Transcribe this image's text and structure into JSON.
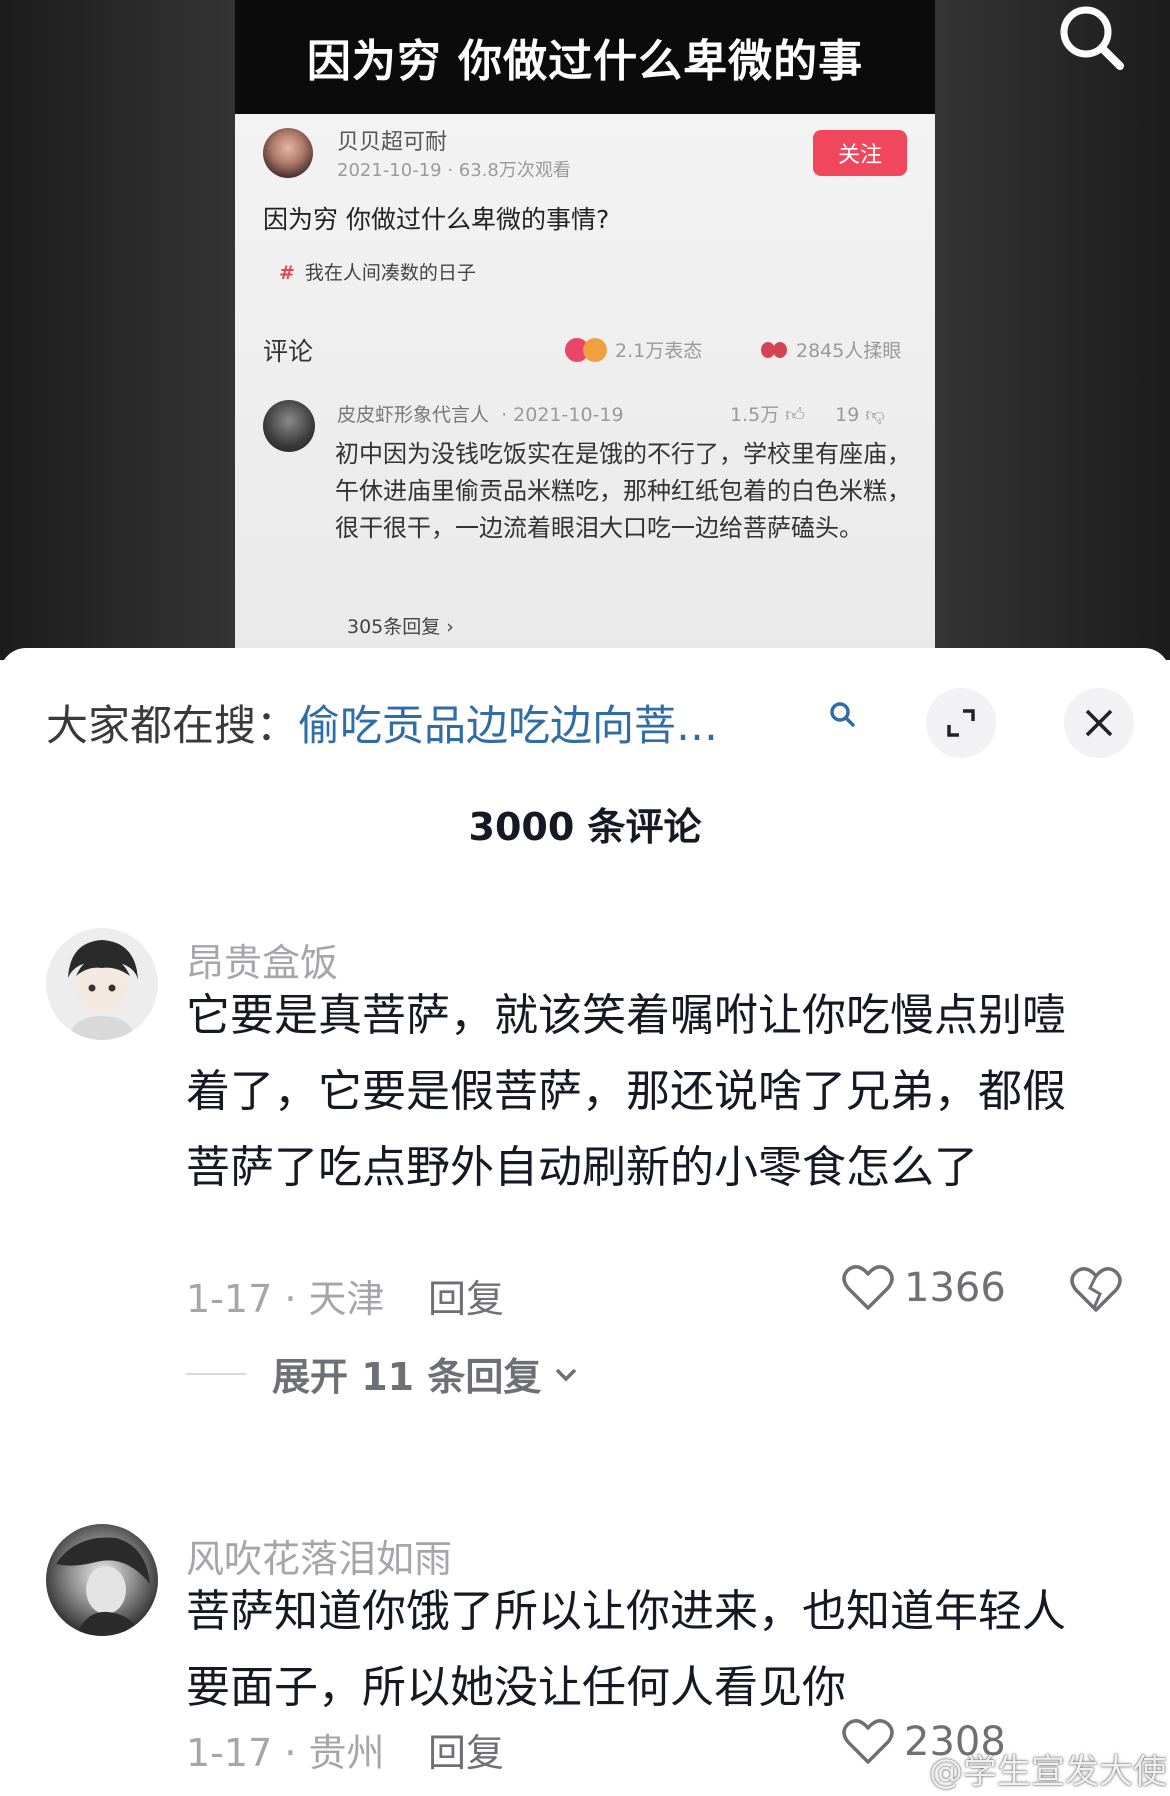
{
  "video": {
    "title": "因为穷 你做过什么卑微的事",
    "search_icon": "search-icon",
    "screenshot": {
      "author": "贝贝超可耐",
      "meta": "2021-10-19 · 63.8万次观看",
      "follow_label": "关注",
      "question": "因为穷 你做过什么卑微的事情?",
      "topic_hash": "#",
      "topic": "我在人间凑数的日子",
      "comments_heading": "评论",
      "reactions": "2.1万表态",
      "rubbed_eyes": "2845人揉眼",
      "comment": {
        "name": "皮皮虾形象代言人",
        "date": "· 2021-10-19",
        "likes": "1.5万",
        "dislikes": "19",
        "text": "初中因为没钱吃饭实在是饿的不行了，学校里有座庙，午休进庙里偷贡品米糕吃，那种红纸包着的白色米糕，很干很干，一边流着眼泪大口吃一边给菩萨磕头。",
        "replies": "305条回复 ›"
      }
    }
  },
  "sheet": {
    "search_prefix": "大家都在搜：",
    "search_term": "偷吃贡品边吃边向菩…",
    "comment_count": "3000 条评论",
    "comments": [
      {
        "author": "昂贵盒饭",
        "text": "它要是真菩萨，就该笑着嘱咐让你吃慢点别噎着了，它要是假菩萨，那还说啥了兄弟，都假菩萨了吃点野外自动刷新的小零食怎么了",
        "meta": "1-17 · 天津",
        "reply_label": "回复",
        "likes": "1366",
        "expand_label": "展开 11 条回复"
      },
      {
        "author": "风吹花落泪如雨",
        "text": "菩萨知道你饿了所以让你进来，也知道年轻人要面子，所以她没让任何人看见你",
        "meta": "1-17 · 贵州",
        "reply_label": "回复",
        "likes": "2308"
      }
    ]
  },
  "watermark": "@学生宣发大使"
}
